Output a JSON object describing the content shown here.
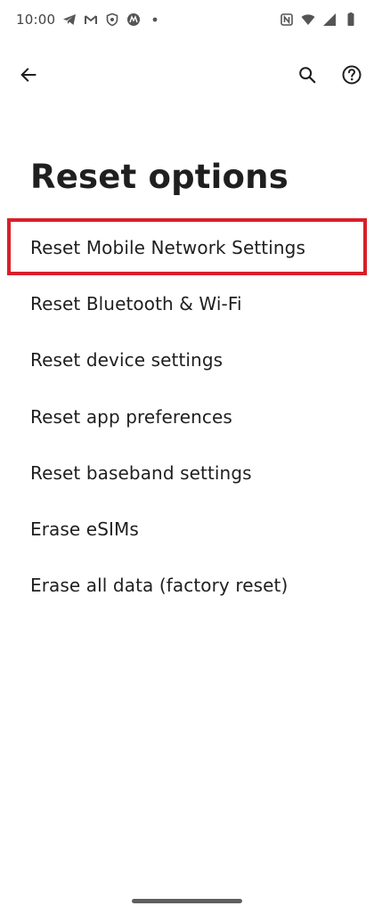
{
  "status_bar": {
    "time": "10:00",
    "left_icons": [
      "telegram-icon",
      "gmail-icon",
      "shield-icon",
      "motorola-icon",
      "dot-icon"
    ],
    "right_icons": [
      "nfc-icon",
      "wifi-icon",
      "signal-icon",
      "battery-icon"
    ]
  },
  "app_bar": {
    "back_icon": "arrow-back-icon",
    "search_icon": "search-icon",
    "help_icon": "help-icon"
  },
  "page": {
    "title": "Reset options"
  },
  "options": [
    {
      "label": "Reset Mobile Network Settings"
    },
    {
      "label": "Reset Bluetooth & Wi-Fi"
    },
    {
      "label": "Reset device settings"
    },
    {
      "label": "Reset app preferences"
    },
    {
      "label": "Reset baseband settings"
    },
    {
      "label": "Erase eSIMs"
    },
    {
      "label": "Erase all data (factory reset)"
    }
  ],
  "highlight": {
    "target_index": 0,
    "color": "#d81f2a"
  },
  "colors": {
    "text": "#1f1f1f",
    "icon": "#1f1f1f",
    "status": "#444444",
    "background": "#ffffff"
  }
}
